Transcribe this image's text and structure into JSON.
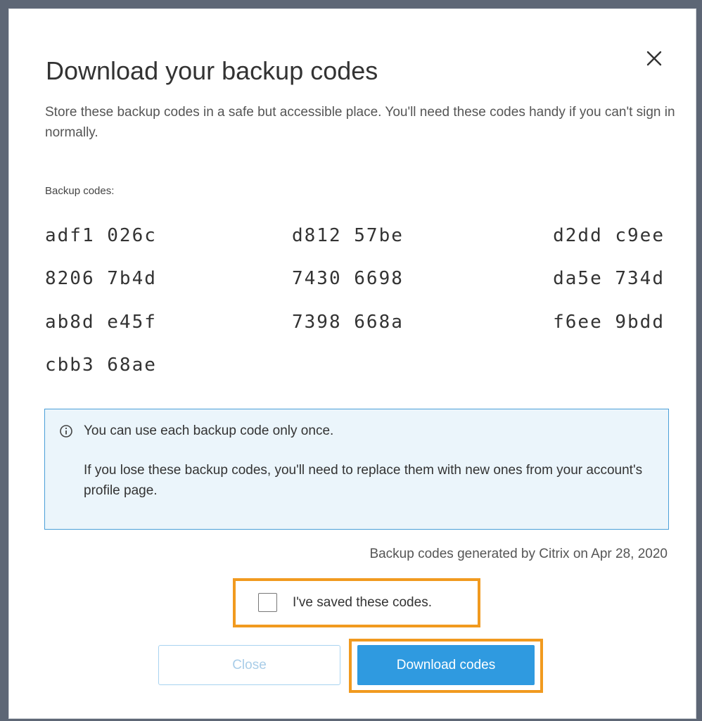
{
  "dialog": {
    "title": "Download your backup codes",
    "description": "Store these backup codes in a safe but accessible place. You'll need these codes handy if you can't sign in normally.",
    "codes_label": "Backup codes:",
    "codes": [
      "adf1 026c",
      "d812 57be",
      "d2dd c9ee",
      "8206 7b4d",
      "7430 6698",
      "da5e 734d",
      "ab8d e45f",
      "7398 668a",
      "f6ee 9bdd",
      "cbb3 68ae"
    ],
    "info": {
      "line1": "You can use each backup code only once.",
      "line2": "If you lose these backup codes, you'll need to replace them with new ones from your account's profile page."
    },
    "generated_text": "Backup codes generated by Citrix on Apr 28, 2020",
    "checkbox": {
      "label": "I've saved these codes.",
      "checked": false
    },
    "buttons": {
      "close_label": "Close",
      "close_enabled": false,
      "download_label": "Download codes"
    }
  },
  "icons": {
    "close": "close-icon",
    "info": "info-icon"
  },
  "colors": {
    "backdrop": "#5d6675",
    "primary": "#2f9ae0",
    "highlight": "#f19a1f",
    "info_background": "#ebf5fb",
    "info_border": "#4a9fd8"
  }
}
